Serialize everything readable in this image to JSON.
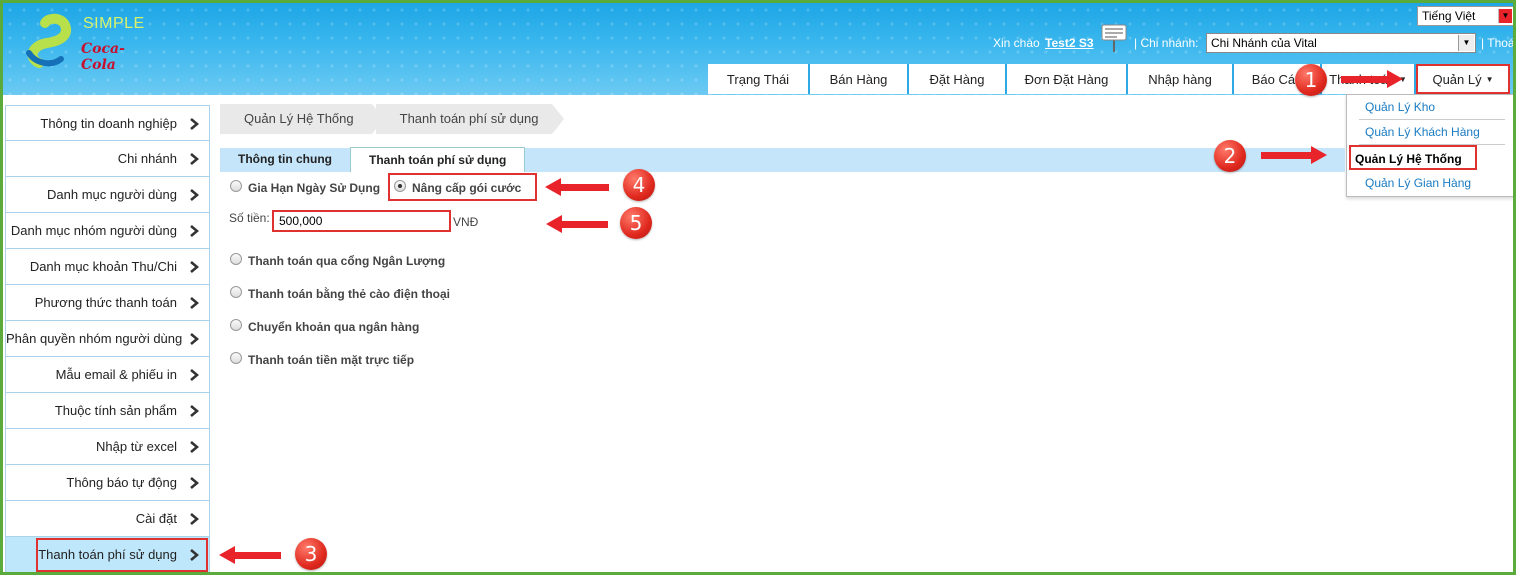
{
  "header": {
    "logo": {
      "brand_text": "SIMPLE",
      "sponsor_text": "Coca-Cola"
    },
    "language": "Tiếng Việt",
    "greeting": "Xin chào",
    "username": "Test2 S3",
    "branch_label": "| Chi nhánh:",
    "branch_value": "Chi Nhánh của Vital",
    "logout": "| Thoát"
  },
  "topnav": {
    "items": [
      {
        "label": "Trạng Thái"
      },
      {
        "label": "Bán Hàng"
      },
      {
        "label": "Đặt Hàng"
      },
      {
        "label": "Đơn Đặt Hàng"
      },
      {
        "label": "Nhập hàng"
      },
      {
        "label": "Báo Cáo"
      },
      {
        "label": "Thanh toán"
      },
      {
        "label": "Quản Lý"
      }
    ]
  },
  "dropdown": {
    "items": [
      {
        "label": "Quản Lý Kho"
      },
      {
        "label": "Quản Lý Khách Hàng"
      },
      {
        "label": "Quản Lý Hệ Thống"
      },
      {
        "label": "Quản Lý Gian Hàng"
      }
    ]
  },
  "sidebar": {
    "items": [
      {
        "label": "Thông tin doanh nghiệp"
      },
      {
        "label": "Chi nhánh"
      },
      {
        "label": "Danh mục người dùng"
      },
      {
        "label": "Danh mục nhóm người dùng"
      },
      {
        "label": "Danh mục khoản Thu/Chi"
      },
      {
        "label": "Phương thức thanh toán"
      },
      {
        "label": "Phân quyền nhóm người dùng"
      },
      {
        "label": "Mẫu email & phiếu in"
      },
      {
        "label": "Thuộc tính sản phẩm"
      },
      {
        "label": "Nhập từ excel"
      },
      {
        "label": "Thông báo tự động"
      },
      {
        "label": "Cài đặt"
      },
      {
        "label": "Thanh toán phí sử dụng"
      }
    ]
  },
  "breadcrumb": {
    "items": [
      {
        "label": "Quản Lý Hệ Thống"
      },
      {
        "label": "Thanh toán phí sử dụng"
      }
    ]
  },
  "tabs": {
    "items": [
      {
        "label": "Thông tin chung"
      },
      {
        "label": "Thanh toán phí sử dụng"
      }
    ]
  },
  "form": {
    "options_top": [
      {
        "label": "Gia Hạn Ngày Sử Dụng"
      },
      {
        "label": "Nâng cấp gói cước"
      }
    ],
    "amount_label": "Số tiền:",
    "amount_value": "500,000",
    "amount_unit": "VNĐ",
    "payment_methods": [
      {
        "label": "Thanh toán qua cổng Ngân Lượng"
      },
      {
        "label": "Thanh toán bằng thẻ cào điện thoại"
      },
      {
        "label": "Chuyển khoản qua ngân hàng"
      },
      {
        "label": "Thanh toán tiền mặt trực tiếp"
      }
    ]
  },
  "annotations": {
    "badges": [
      "1",
      "2",
      "3",
      "4",
      "5"
    ]
  },
  "colors": {
    "header": "#1da6e6",
    "accent_red": "#e03131",
    "frame_green": "#5bab3c",
    "link_blue": "#1a7bc2",
    "tab_bar": "#c5e6fa"
  }
}
